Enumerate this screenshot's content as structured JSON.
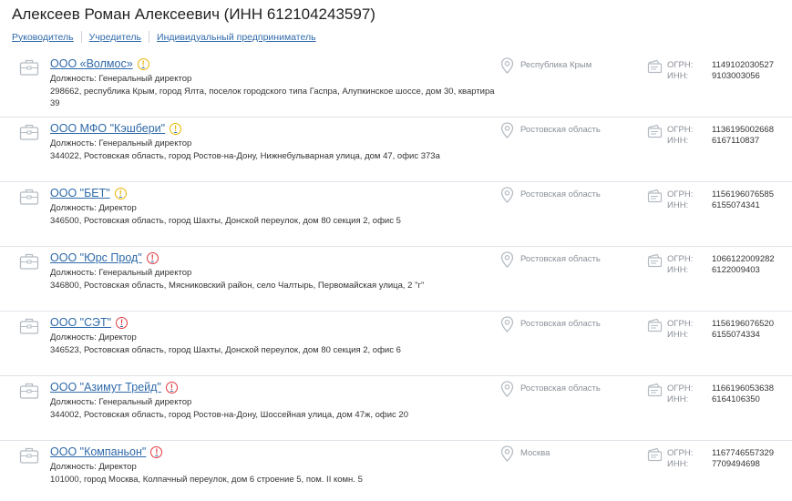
{
  "page": {
    "title": "Алексеев Роман Алексеевич (ИНН 612104243597)",
    "tabs": [
      "Руководитель",
      "Учредитель",
      "Индивидуальный предприниматель"
    ]
  },
  "labels": {
    "ogrn": "ОГРН:",
    "inn": "ИНН:"
  },
  "colors": {
    "link": "#2f6aa9",
    "warning": "#e9b400",
    "danger": "#e0393e",
    "muted": "#8a9099"
  },
  "companies": [
    {
      "name": "ООО «Волмос»",
      "status": "warning",
      "position": "Должность: Генеральный директор",
      "address": "298662, республика Крым, город Ялта, поселок городского типа Гаспра, Алупкинское шоссе, дом 30, квартира 39",
      "region": "Республика Крым",
      "ogrn": "1149102030527",
      "inn": "9103003056"
    },
    {
      "name": "ООО МФО \"Кэшбери\"",
      "status": "warning",
      "position": "Должность: Генеральный директор",
      "address": "344022, Ростовская область, город Ростов-на-Дону, Нижнебульварная улица, дом 47, офис 373а",
      "region": "Ростовская область",
      "ogrn": "1136195002668",
      "inn": "6167110837"
    },
    {
      "name": "ООО \"БЕТ\"",
      "status": "warning",
      "position": "Должность: Директор",
      "address": "346500, Ростовская область, город Шахты, Донской переулок, дом 80 секция 2, офис 5",
      "region": "Ростовская область",
      "ogrn": "1156196076585",
      "inn": "6155074341"
    },
    {
      "name": "ООО \"Юрс Прод\"",
      "status": "danger",
      "position": "Должность: Генеральный директор",
      "address": "346800, Ростовская область, Мясниковский район, село Чалтырь, Первомайская улица, 2 \"г\"",
      "region": "Ростовская область",
      "ogrn": "1066122009282",
      "inn": "6122009403"
    },
    {
      "name": "ООО \"СЭТ\"",
      "status": "danger",
      "position": "Должность: Директор",
      "address": "346523, Ростовская область, город Шахты, Донской переулок, дом 80 секция 2, офис 6",
      "region": "Ростовская область",
      "ogrn": "1156196076520",
      "inn": "6155074334"
    },
    {
      "name": "ООО \"Азимут Трейд\"",
      "status": "danger",
      "position": "Должность: Генеральный директор",
      "address": "344002, Ростовская область, город Ростов-на-Дону, Шоссейная улица, дом 47ж, офис 20",
      "region": "Ростовская область",
      "ogrn": "1166196053638",
      "inn": "6164106350"
    },
    {
      "name": "ООО \"Компаньон\"",
      "status": "danger",
      "position": "Должность: Директор",
      "address": "101000, город Москва, Колпачный переулок, дом 6 строение 5, пом. II комн. 5",
      "region": "Москва",
      "ogrn": "1167746557329",
      "inn": "7709494698"
    }
  ]
}
